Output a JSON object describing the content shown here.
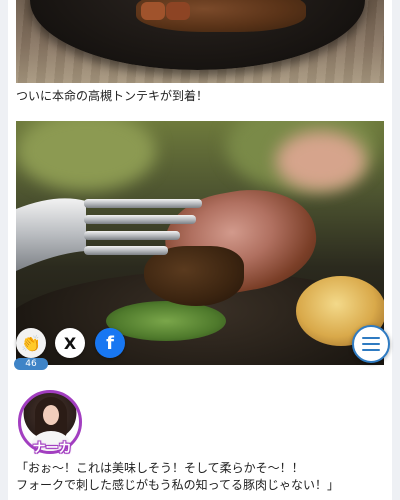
{
  "caption1": "ついに本命の高槻トンテキが到着！",
  "share": {
    "clap_count": "46",
    "x_label": "X",
    "fb_label": "f"
  },
  "speaker": {
    "name": "ナーカ"
  },
  "speech": {
    "line1": "「おぉ～！これは美味しそう！そして柔らかそ～！！",
    "line2": "フォークで刺した感じがもう私の知ってる豚肉じゃない！」"
  },
  "colors": {
    "accent": "#2f7bc2",
    "facebook": "#1877f2",
    "avatar_ring": "#a23ec0",
    "badge": "#3f84c7"
  },
  "icons": [
    "clap-icon",
    "x-logo-icon",
    "facebook-icon",
    "hamburger-menu-icon"
  ]
}
